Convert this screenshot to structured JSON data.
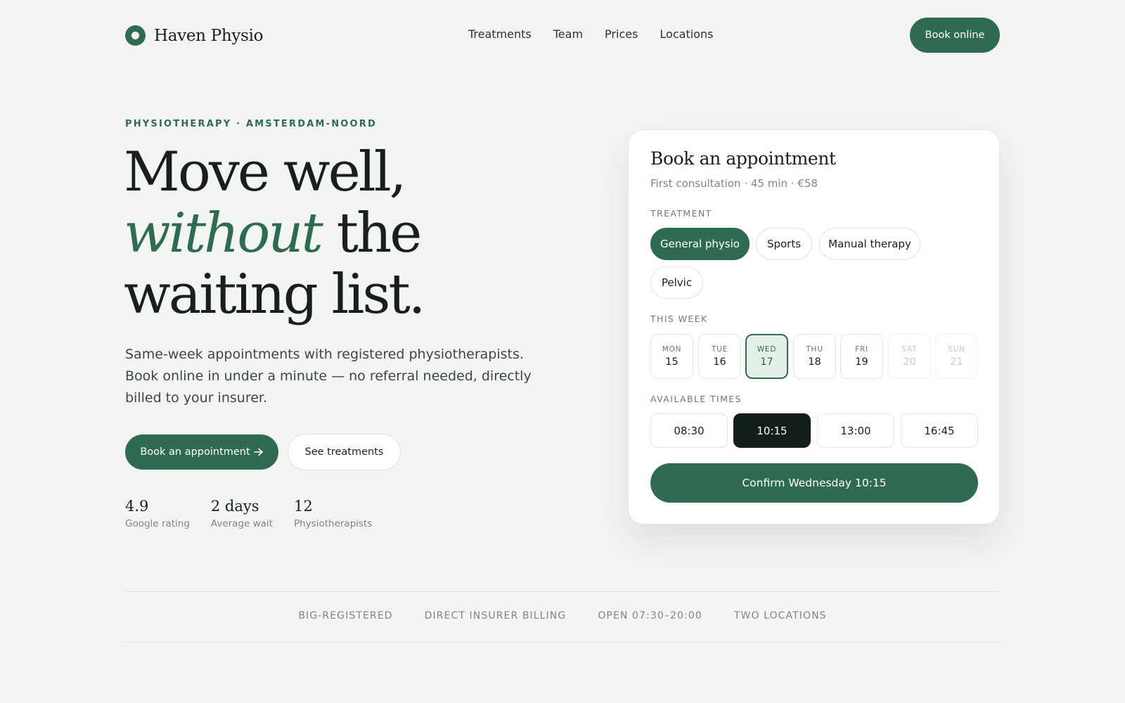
{
  "brand": {
    "name": "Haven Physio",
    "accent": "#2f6b51",
    "dark": "#13201a",
    "background": "#f3f5f2"
  },
  "nav": {
    "items": [
      "Treatments",
      "Team",
      "Prices",
      "Locations"
    ]
  },
  "header": {
    "cta_label": "Book online"
  },
  "hero": {
    "eyebrow": "PHYSIOTHERAPY · AMSTERDAM-NOORD",
    "headline": {
      "line1": "Move well,",
      "emphasis": "without",
      "line2_rest": "the",
      "line3": "waiting list."
    },
    "lede": "Same-week appointments with registered physiotherapists. Book online in under a minute — no referral needed, directly billed to your insurer.",
    "primary_cta": "Book an appointment",
    "primary_cta_icon": "arrow-right-icon",
    "secondary_cta": "See treatments",
    "stats": [
      {
        "value": "4.9",
        "label": "Google rating"
      },
      {
        "value": "2 days",
        "label": "Average wait"
      },
      {
        "value": "12",
        "label": "Physiotherapists"
      }
    ]
  },
  "booking": {
    "title": "Book an appointment",
    "subtitle": "First consultation · 45 min · €58",
    "treatment_label": "TREATMENT",
    "treatments": [
      {
        "label": "General physio",
        "selected": true
      },
      {
        "label": "Sports",
        "selected": false
      },
      {
        "label": "Manual therapy",
        "selected": false
      },
      {
        "label": "Pelvic",
        "selected": false
      }
    ],
    "week_label": "THIS WEEK",
    "days": [
      {
        "name": "MON",
        "date": "15",
        "state": "available"
      },
      {
        "name": "TUE",
        "date": "16",
        "state": "available"
      },
      {
        "name": "WED",
        "date": "17",
        "state": "selected"
      },
      {
        "name": "THU",
        "date": "18",
        "state": "available"
      },
      {
        "name": "FRI",
        "date": "19",
        "state": "available"
      },
      {
        "name": "SAT",
        "date": "20",
        "state": "disabled"
      },
      {
        "name": "SUN",
        "date": "21",
        "state": "disabled"
      }
    ],
    "times_label": "AVAILABLE TIMES",
    "times": [
      {
        "label": "08:30",
        "selected": false
      },
      {
        "label": "10:15",
        "selected": true
      },
      {
        "label": "13:00",
        "selected": false
      },
      {
        "label": "16:45",
        "selected": false
      }
    ],
    "confirm_label": "Confirm Wednesday 10:15"
  },
  "trust": {
    "items": [
      "BIG-REGISTERED",
      "DIRECT INSURER BILLING",
      "OPEN 07:30–20:00",
      "TWO LOCATIONS"
    ]
  }
}
